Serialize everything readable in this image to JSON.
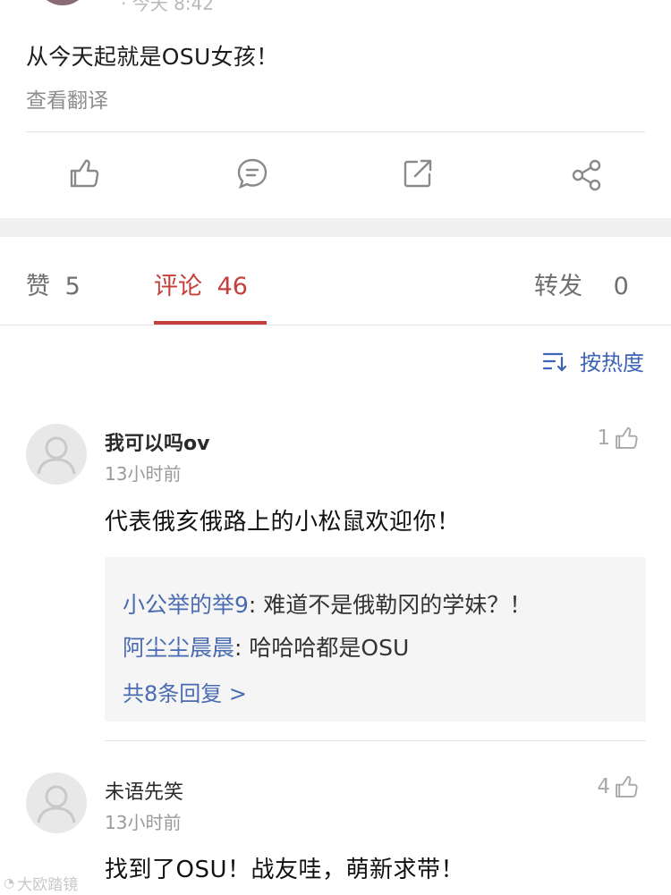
{
  "post": {
    "meta_peek": "· 今天 8:42",
    "text": "从今天起就是OSU女孩！",
    "translate_label": "查看翻译"
  },
  "actions": [
    {
      "icon": "thumb-up-icon"
    },
    {
      "icon": "comment-bubble-icon"
    },
    {
      "icon": "repost-icon"
    },
    {
      "icon": "share-icon"
    }
  ],
  "tabs": {
    "likes": {
      "label": "赞",
      "count": "5"
    },
    "comments": {
      "label": "评论",
      "count": "46"
    },
    "reposts": {
      "label": "转发",
      "count": "0"
    }
  },
  "sort": {
    "label": "按热度",
    "icon": "sort-icon"
  },
  "comments": [
    {
      "username": "我可以吗ov",
      "time": "13小时前",
      "likes": "1",
      "text": "代表俄亥俄路上的小松鼠欢迎你！",
      "replies": [
        {
          "name": "小公举的举9",
          "text": "难道不是俄勒冈的学妹？！"
        },
        {
          "name": "阿尘尘晨晨",
          "text": "哈哈哈都是OSU"
        }
      ],
      "more_replies": "共8条回复 >"
    },
    {
      "username": "未语先笑",
      "time": "13小时前",
      "likes": "4",
      "text": "找到了OSU！战友哇，萌新求带！"
    }
  ],
  "watermark": "大欧踏镜",
  "colors": {
    "accent": "#c4403d",
    "link": "#4a6bb1",
    "band": "#f0f0f0"
  }
}
